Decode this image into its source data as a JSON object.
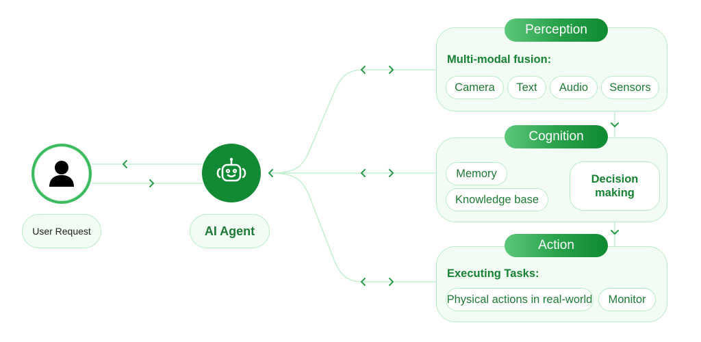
{
  "colors": {
    "primary_green": "#118a33",
    "text_green": "#1f7a38",
    "line_green": "#c4efd1",
    "arrow_green": "#2a9a4a",
    "panel_fill": "#f2fbf4",
    "panel_border": "#b9ecc8"
  },
  "user": {
    "icon": "user-icon",
    "label": "User Request"
  },
  "agent": {
    "icon": "robot-icon",
    "label": "AI Agent"
  },
  "perception": {
    "title": "Perception",
    "subtitle": "Multi-modal fusion:",
    "chips": [
      "Camera",
      "Text",
      "Audio",
      "Sensors"
    ]
  },
  "cognition": {
    "title": "Cognition",
    "inputs": [
      "Memory",
      "Knowledge base"
    ],
    "decision_line1": "Decision",
    "decision_line2": "making"
  },
  "action": {
    "title": "Action",
    "subtitle": "Executing Tasks:",
    "chips": [
      "Physical actions in real-world",
      "Monitor"
    ]
  },
  "connectors": {
    "arrow_left_icon": "chevron-left-icon",
    "arrow_right_icon": "chevron-right-icon",
    "arrow_down_icon": "chevron-down-icon"
  }
}
